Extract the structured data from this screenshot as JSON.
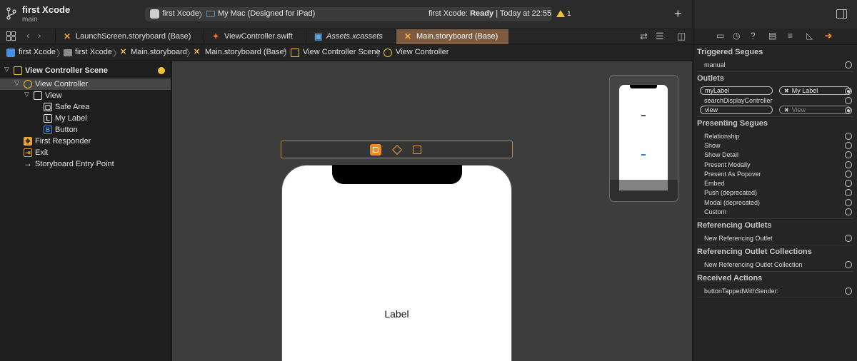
{
  "titlebar": {
    "project_name": "first Xcode",
    "branch": "main",
    "scheme_app": "first Xcode",
    "scheme_separator": "〉",
    "destination": "My Mac (Designed for iPad)",
    "status_project": "first Xcode:",
    "status_state": "Ready",
    "status_time": "| Today at 22:55",
    "warning_count": "1",
    "add_button": "+"
  },
  "tabs": [
    {
      "label": "LaunchScreen.storyboard (Base)",
      "icon": "storyboard-icon"
    },
    {
      "label": "ViewController.swift",
      "icon": "swift-icon"
    },
    {
      "label": "Assets.xcassets",
      "icon": "asset-catalog-icon"
    },
    {
      "label": "Main.storyboard (Base)",
      "icon": "storyboard-icon",
      "active": true
    }
  ],
  "breadcrumbs": [
    "first Xcode",
    "first Xcode",
    "Main.storyboard",
    "Main.storyboard (Base)",
    "View Controller Scene",
    "View Controller"
  ],
  "outline": {
    "scene": "View Controller Scene",
    "view_controller": "View Controller",
    "view": "View",
    "safe_area": "Safe Area",
    "my_label": "My Label",
    "button": "Button",
    "first_responder": "First Responder",
    "exit": "Exit",
    "entry_point": "Storyboard Entry Point"
  },
  "canvas": {
    "device_label": "Label"
  },
  "inspector": {
    "triggered_segues": {
      "title": "Triggered Segues",
      "items": [
        "manual"
      ]
    },
    "outlets": {
      "title": "Outlets",
      "my_label_name": "myLabel",
      "my_label_target": "My Label",
      "search_display": "searchDisplayController",
      "view_name": "view",
      "view_target": "View"
    },
    "presenting_segues": {
      "title": "Presenting Segues",
      "items": [
        "Relationship",
        "Show",
        "Show Detail",
        "Present Modally",
        "Present As Popover",
        "Embed",
        "Push (deprecated)",
        "Modal (deprecated)",
        "Custom"
      ]
    },
    "referencing_outlets": {
      "title": "Referencing Outlets",
      "items": [
        "New Referencing Outlet"
      ]
    },
    "referencing_collections": {
      "title": "Referencing Outlet Collections",
      "items": [
        "New Referencing Outlet Collection"
      ]
    },
    "received_actions": {
      "title": "Received Actions",
      "items": [
        "buttonTappedWithSender:"
      ]
    }
  },
  "colors": {
    "accent_orange": "#f08a24",
    "active_tab": "#7e5b3f",
    "warning_yellow": "#f2c230",
    "link_blue": "#4b8fe0"
  }
}
